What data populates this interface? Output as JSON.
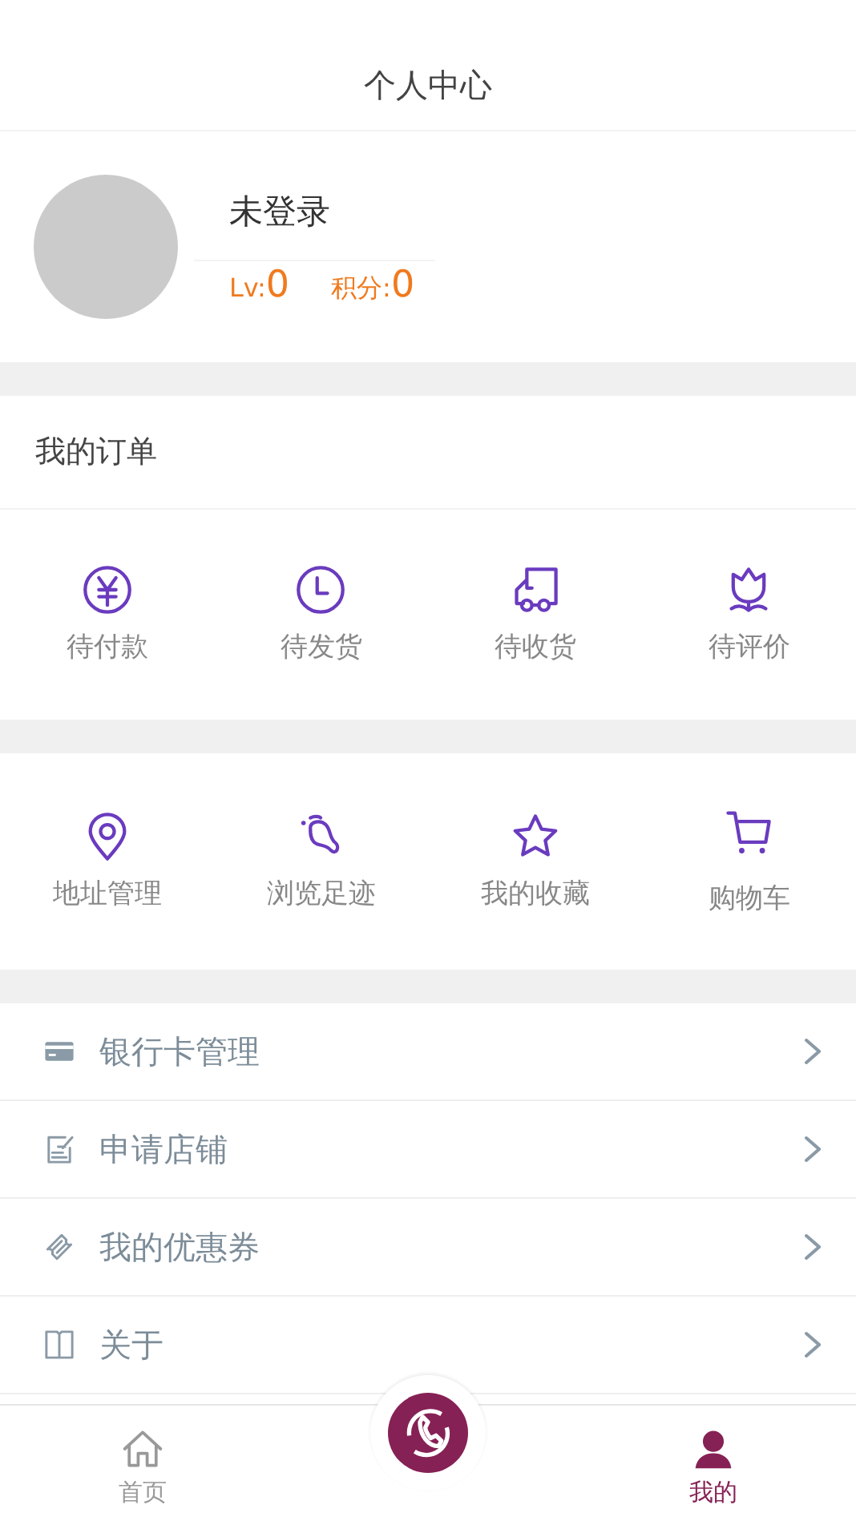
{
  "header": {
    "title": "个人中心"
  },
  "profile": {
    "name": "未登录",
    "level_label": "Lv:",
    "level_value": "0",
    "points_label": "积分:",
    "points_value": "0"
  },
  "orders": {
    "title": "我的订单",
    "items": [
      {
        "label": "待付款"
      },
      {
        "label": "待发货"
      },
      {
        "label": "待收货"
      },
      {
        "label": "待评价"
      }
    ]
  },
  "shortcuts": [
    {
      "label": "地址管理"
    },
    {
      "label": "浏览足迹"
    },
    {
      "label": "我的收藏"
    },
    {
      "label": "购物车"
    }
  ],
  "menu": [
    {
      "label": "银行卡管理"
    },
    {
      "label": "申请店铺"
    },
    {
      "label": "我的优惠券"
    },
    {
      "label": "关于"
    }
  ],
  "tab_bar": [
    {
      "kind": "tab",
      "label": "首页",
      "selected": false
    },
    {
      "kind": "center"
    },
    {
      "kind": "tab",
      "label": "我的",
      "selected": true
    }
  ]
}
